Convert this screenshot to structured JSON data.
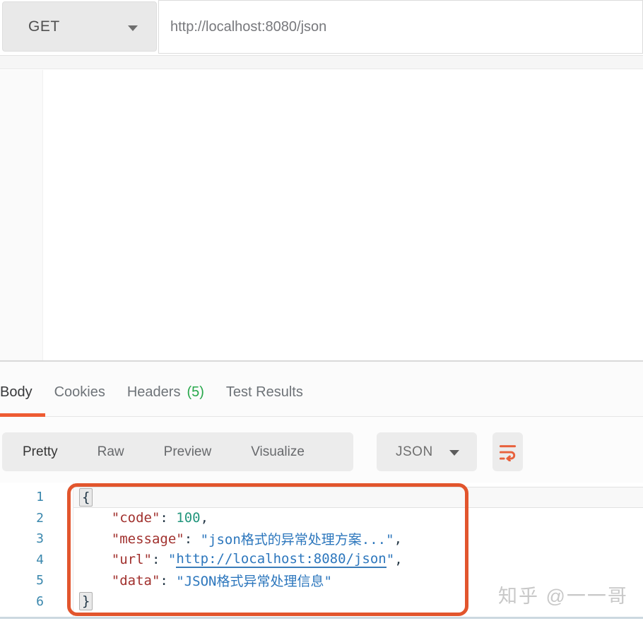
{
  "request_bar": {
    "method": "GET",
    "url": "http://localhost:8080/json"
  },
  "icons": {
    "method_caret": "triangle-down",
    "language_caret": "triangle-down",
    "wrap_button": "wrap-text"
  },
  "response_tabs": {
    "tabs": [
      {
        "label": "Body",
        "active": true
      },
      {
        "label": "Cookies",
        "active": false
      },
      {
        "label": "Headers",
        "count": "(5)",
        "active": false
      },
      {
        "label": "Test Results",
        "active": false
      }
    ]
  },
  "view_toolbar": {
    "views": [
      {
        "label": "Pretty",
        "active": true
      },
      {
        "label": "Raw",
        "active": false
      },
      {
        "label": "Preview",
        "active": false
      },
      {
        "label": "Visualize",
        "active": false
      }
    ],
    "language_selected": "JSON"
  },
  "editor": {
    "lines": [
      {
        "number": "1",
        "current": true,
        "tokens": [
          {
            "type": "bracket",
            "text": "{"
          }
        ]
      },
      {
        "number": "2",
        "tokens": [
          {
            "type": "plain",
            "text": "    "
          },
          {
            "type": "key",
            "text": "\"code\""
          },
          {
            "type": "punct",
            "text": ": "
          },
          {
            "type": "number",
            "text": "100"
          },
          {
            "type": "punct",
            "text": ","
          }
        ]
      },
      {
        "number": "3",
        "tokens": [
          {
            "type": "plain",
            "text": "    "
          },
          {
            "type": "key",
            "text": "\"message\""
          },
          {
            "type": "punct",
            "text": ": "
          },
          {
            "type": "string",
            "text": "\"json格式的异常处理方案...\""
          },
          {
            "type": "punct",
            "text": ","
          }
        ]
      },
      {
        "number": "4",
        "tokens": [
          {
            "type": "plain",
            "text": "    "
          },
          {
            "type": "key",
            "text": "\"url\""
          },
          {
            "type": "punct",
            "text": ": "
          },
          {
            "type": "string",
            "text": "\""
          },
          {
            "type": "link",
            "text": "http://localhost:8080/json"
          },
          {
            "type": "string",
            "text": "\""
          },
          {
            "type": "punct",
            "text": ","
          }
        ]
      },
      {
        "number": "5",
        "tokens": [
          {
            "type": "plain",
            "text": "    "
          },
          {
            "type": "key",
            "text": "\"data\""
          },
          {
            "type": "punct",
            "text": ": "
          },
          {
            "type": "string",
            "text": "\"JSON格式异常处理信息\""
          }
        ]
      },
      {
        "number": "6",
        "tokens": [
          {
            "type": "bracket",
            "text": "}"
          }
        ]
      }
    ]
  },
  "watermark": "知乎 @一一哥",
  "colors": {
    "accent_orange": "#ee5b32",
    "annotation_orange": "#e2552d",
    "headers_count_green": "#29a84c",
    "line_number_blue": "#3a87ad",
    "json_key_red": "#a1312e",
    "json_string_blue": "#2d77bd",
    "json_number_teal": "#23967d"
  }
}
